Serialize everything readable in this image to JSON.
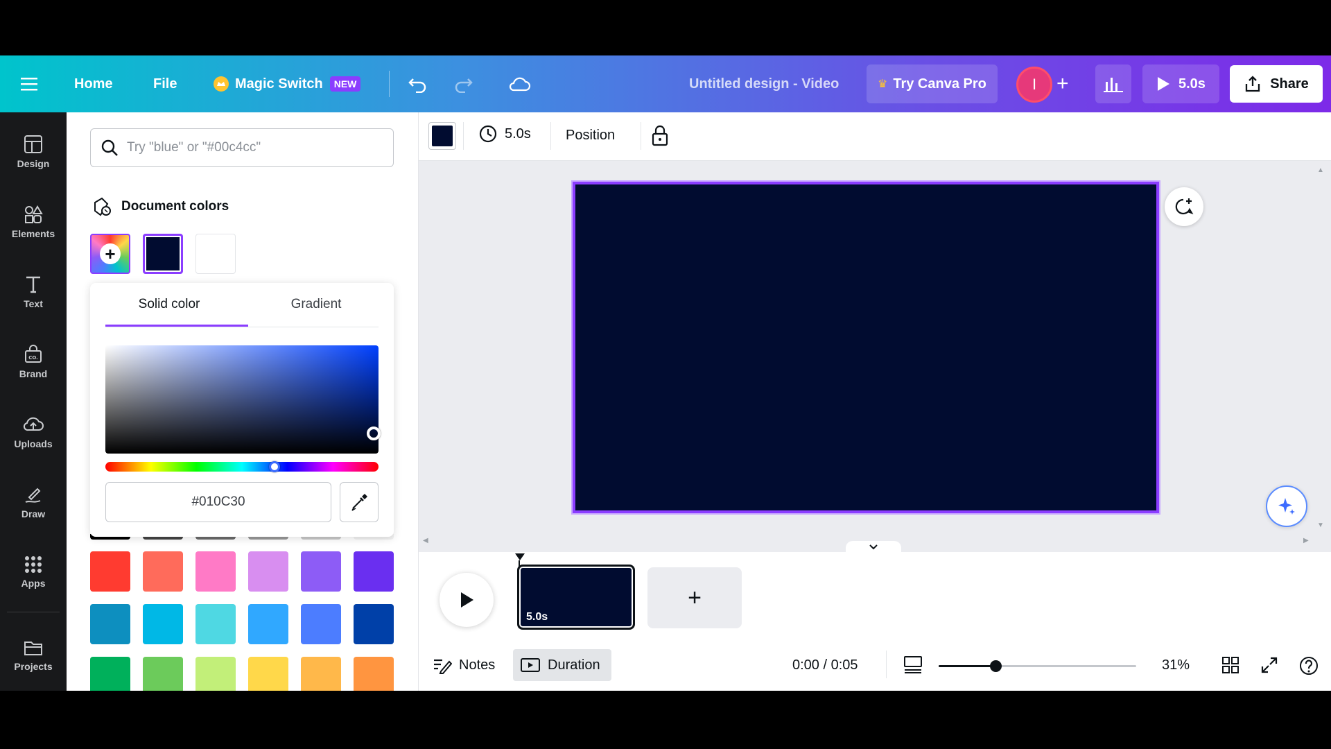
{
  "topbar": {
    "home": "Home",
    "file": "File",
    "magic_switch": "Magic Switch",
    "new_badge": "NEW",
    "doc_title": "Untitled design - Video",
    "try_pro": "Try Canva Pro",
    "avatar_initial": "I",
    "play_duration": "5.0s",
    "share": "Share"
  },
  "rail": {
    "items": [
      "Design",
      "Elements",
      "Text",
      "Brand",
      "Uploads",
      "Draw",
      "Apps",
      "Projects"
    ]
  },
  "panel": {
    "search_placeholder": "Try \"blue\" or \"#00c4cc\"",
    "doc_colors_title": "Document colors",
    "tabs": {
      "solid": "Solid color",
      "gradient": "Gradient"
    },
    "hex_value": "#010C30",
    "doc_swatches": [
      "#010c30",
      "#ffffff"
    ],
    "palette_rows": [
      [
        "#ff3b30",
        "#ff6b5b",
        "#ff7ac6",
        "#d88ef0",
        "#8d5cf6",
        "#6a2ff0"
      ],
      [
        "#0d8fbf",
        "#00b8e6",
        "#4fd8e3",
        "#30a8ff",
        "#4c7dff",
        "#0040a8"
      ],
      [
        "#00b05b",
        "#6ccb5b",
        "#c2ef79",
        "#ffd84a",
        "#ffb84a",
        "#ff9540"
      ]
    ]
  },
  "ctx": {
    "color": "#010c30",
    "duration": "5.0s",
    "position": "Position"
  },
  "timeline": {
    "clip_duration": "5.0s"
  },
  "footer": {
    "notes": "Notes",
    "duration": "Duration",
    "time": "0:00 / 0:05",
    "zoom": "31%"
  },
  "colors": {
    "accent": "#8b3dff",
    "canvas": "#010c30"
  }
}
